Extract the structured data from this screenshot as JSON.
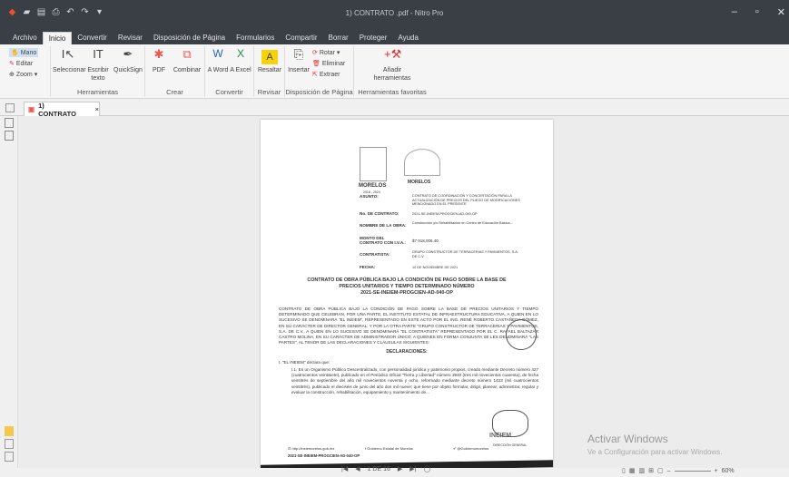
{
  "window": {
    "title": "1) CONTRATO .pdf - Nitro Pro"
  },
  "menu": [
    "Archivo",
    "Inicio",
    "Convertir",
    "Revisar",
    "Disposición de Página",
    "Formularios",
    "Compartir",
    "Borrar",
    "Proteger",
    "Ayuda"
  ],
  "ribbon": {
    "mano": "Mano",
    "editar": "Editar",
    "zoom": "Zoom ▾",
    "seleccionar": "Seleccionar",
    "escribir": "Escribir texto",
    "quicksign": "QuickSign",
    "herramientas": "Herramientas",
    "pdf": "PDF",
    "combinar": "Combinar",
    "crear": "Crear",
    "word": "A Word",
    "excel": "A Excel",
    "convertir": "Convertir",
    "resaltar": "Resaltar",
    "revisar": "Revisar",
    "insertar": "Insertar",
    "rotar": "Rotar ▾",
    "eliminar": "Eliminar",
    "extraer": "Extraer",
    "disposicion": "Disposición de Página",
    "anadir": "Añadir herramientas",
    "favoritas": "Herramientas favoritas"
  },
  "tab": {
    "label": "1) CONTRATO",
    "close": "×"
  },
  "doc": {
    "brand1": "MORELOS",
    "brand1sub": "2018 - 2024",
    "brand2": "MORELOS",
    "rows": [
      {
        "k": "ASUNTO:",
        "v": "CONTRATO DE COORDINACIÓN Y CONCERTACIÓN PARA LA ACTUALIZACIÓN DE PRECIOS DEL PLIEGO DE MODIFICACIONES MENCIONADO EN EL PRESENTE"
      },
      {
        "k": "No. DE CONTRATO:",
        "v": "2021-SE-INEIEM-PROGCIEN-AD-040-OP"
      },
      {
        "k": "NOMBRE DE LA OBRA:",
        "v": "Construcción y/o Rehabilitación en Centro de Educación Básica..."
      },
      {
        "k": "MONTO DEL CONTRATO CON I.V.A.:",
        "v": "$7 918,006.40"
      },
      {
        "k": "CONTRATISTA:",
        "v": "GRUPO CONSTRUCTOR DE TERRACERIAS Y PAVIMENTOS, S.A. DE C.V."
      },
      {
        "k": "FECHA:",
        "v": "10 DE NOVIEMBRE DE 2021"
      }
    ],
    "heading1": "CONTRATO DE OBRA PÚBLICA BAJO LA CONDICIÓN DE PAGO SOBRE LA BASE DE",
    "heading2": "PRECIOS UNITARIOS Y TIEMPO DETERMINADO NÚMERO",
    "heading3": "2021-SE-INEIEM-PROGCIEN-AD-040-OP",
    "para1": "CONTRATO DE OBRA PÚBLICA BAJO LA CONDICIÓN DE PAGO SOBRE LA BASE DE PRECIOS UNITARIOS Y TIEMPO DETERMINADO QUE CELEBRAN, POR UNA PARTE, EL INSTITUTO ESTATAL DE INFRAESTRUCTURA EDUCATIVA, A QUIEN EN LO SUCESIVO SE DENOMINARÁ \"EL INEIEM\", REPRESENTADO EN ESTE ACTO POR EL ING. RENÉ ROBERTO CASTAÑEDA GÓMEZ, EN SU CARÁCTER DE DIRECTOR GENERAL; Y POR LA OTRA PARTE \"GRUPO CONSTRUCTOR DE TERRACERIAS Y PAVIMENTOS, S.A. DE C.V., A QUIEN EN LO SUCESIVO SE DENOMINARÁ \"EL CONTRATISTA\" REPRESENTADO POR EL C. RAFAEL BALTAZAR CASTRO MOLINA, EN SU CARÁCTER DE ADMINISTRADOR ÚNICO; A QUIENES EN FORMA CONJUNTA SE LES DENOMINARÁ \"LAS PARTES\", AL TENOR DE LAS DECLARACIONES Y CLÁUSULAS SIGUIENTES:",
    "declaraciones": "DECLARACIONES:",
    "item1": "I.    \"EL INEIEM\" declara que:",
    "para2": "I.1. Es un Organismo Público Descentralizado, con personalidad jurídica y patrimonio propios, creado mediante Decreto número 427 (cuatrocientos veintisiete), publicado en el Periódico Oficial \"Tierra y Libertad\" número 3940 (tres mil novecientos cuarenta), de fecha veintitrés de septiembre del año mil novecientos noventa y ocho, reformado mediante decreto número 1423 (mil cuatrocientos veintitrés), publicado el dieciséis de junio del año dos mil nueve; que tiene por objeto formular, dirigir, planear, administrar, regular y evaluar la construcción, rehabilitación, equipamiento y mantenimiento de...",
    "footer1": "http://ineiemorelos.gob.mx",
    "footer2": "Gobierno Estatal de Morelos",
    "footer3": "@Gobiernomorelos",
    "footer4": "2021-SE-INEIEM-PROGCIEN-AD-040-OP",
    "footer5": "DIRECCIÓN GENERAL",
    "ineiem": "INEIEM"
  },
  "watermark": {
    "line1": "Activar Windows",
    "line2": "Ve a Configuración para activar Windows."
  },
  "pager": {
    "text": "1 DE 16"
  },
  "zoom": "60%"
}
